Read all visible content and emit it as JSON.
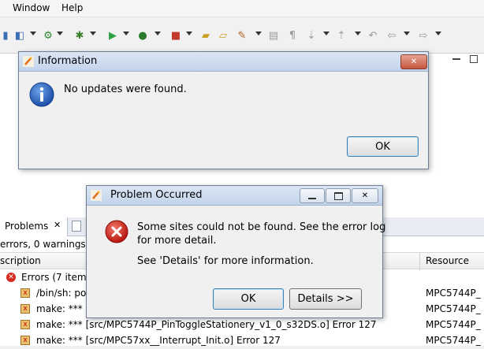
{
  "menubar": {
    "items": [
      "Window",
      "Help"
    ]
  },
  "problems_view": {
    "tab_label": "Problems",
    "summary": "errors, 0 warnings,",
    "columns": [
      "scription",
      "Resource"
    ],
    "rows": [
      {
        "text": "Errors (7 items",
        "resource": ""
      },
      {
        "text": "/bin/sh: po",
        "resource": "MPC5744P_"
      },
      {
        "text": "make: *** [",
        "resource": "MPC5744P_"
      },
      {
        "text": "make: *** [src/MPC5744P_PinToggleStationery_v1_0_s32DS.o] Error 127",
        "resource": "MPC5744P_"
      },
      {
        "text": "make: *** [src/MPC57xx__Interrupt_Init.o] Error 127",
        "resource": "MPC5744P_"
      }
    ]
  },
  "info_dialog": {
    "title": "Information",
    "message": "No updates were found.",
    "ok_label": "OK",
    "close_glyph": "✕"
  },
  "problem_dialog": {
    "title": "Problem Occurred",
    "message_line1": "Some sites could not be found.  See the error log",
    "message_line2": "for more detail.",
    "details_hint": "See 'Details' for more information.",
    "ok_label": "OK",
    "details_label": "Details >>"
  },
  "colors": {
    "error_red": "#d42a20",
    "info_blue": "#2c5fb8",
    "title_gradient_top": "#dbe6f4"
  },
  "icons": [
    "info-icon",
    "error-icon",
    "eclipse-icon",
    "minimize-icon",
    "maximize-icon",
    "close-icon"
  ]
}
